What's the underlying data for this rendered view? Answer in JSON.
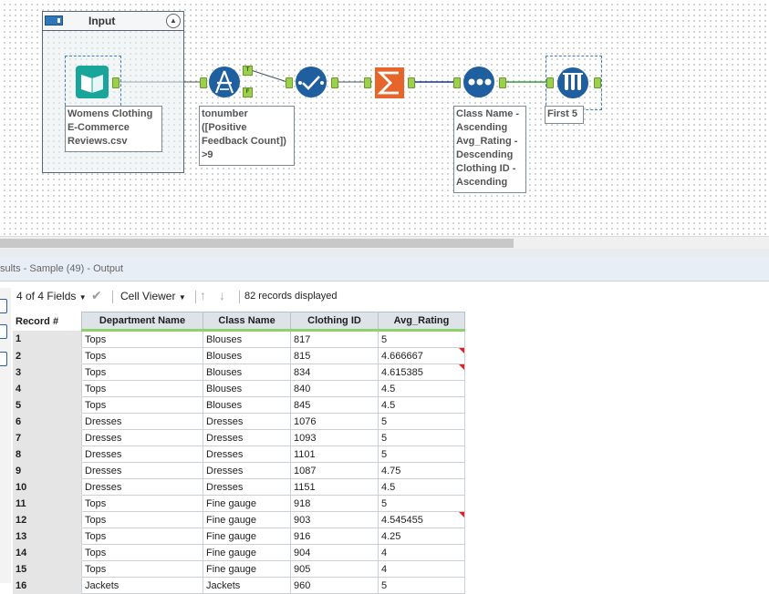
{
  "container": {
    "title": "Input"
  },
  "tools": {
    "input": {
      "label": "Womens Clothing\nE-Commerce\nReviews.csv"
    },
    "filter": {
      "label": "tonumber\n([Positive\nFeedback Count])\n>9",
      "true_anchor": "T",
      "false_anchor": "F"
    },
    "sort": {
      "label": "Class Name -\nAscending\nAvg_Rating -\nDescending\nClothing ID -\nAscending"
    },
    "sample": {
      "label": "First 5"
    }
  },
  "results": {
    "title": "sults - Sample (49) - Output",
    "fields": "4 of 4 Fields",
    "viewer": "Cell Viewer",
    "records": "82 records displayed"
  },
  "table": {
    "columns": [
      "Record #",
      "Department Name",
      "Class Name",
      "Clothing ID",
      "Avg_Rating"
    ],
    "rows": [
      [
        "1",
        "Tops",
        "Blouses",
        "817",
        "5",
        false
      ],
      [
        "2",
        "Tops",
        "Blouses",
        "815",
        "4.666667",
        true
      ],
      [
        "3",
        "Tops",
        "Blouses",
        "834",
        "4.615385",
        true
      ],
      [
        "4",
        "Tops",
        "Blouses",
        "840",
        "4.5",
        false
      ],
      [
        "5",
        "Tops",
        "Blouses",
        "845",
        "4.5",
        false
      ],
      [
        "6",
        "Dresses",
        "Dresses",
        "1076",
        "5",
        false
      ],
      [
        "7",
        "Dresses",
        "Dresses",
        "1093",
        "5",
        false
      ],
      [
        "8",
        "Dresses",
        "Dresses",
        "1101",
        "5",
        false
      ],
      [
        "9",
        "Dresses",
        "Dresses",
        "1087",
        "4.75",
        false
      ],
      [
        "10",
        "Dresses",
        "Dresses",
        "1151",
        "4.5",
        false
      ],
      [
        "11",
        "Tops",
        "Fine gauge",
        "918",
        "5",
        false
      ],
      [
        "12",
        "Tops",
        "Fine gauge",
        "903",
        "4.545455",
        true
      ],
      [
        "13",
        "Tops",
        "Fine gauge",
        "916",
        "4.25",
        false
      ],
      [
        "14",
        "Tops",
        "Fine gauge",
        "904",
        "4",
        false
      ],
      [
        "15",
        "Tops",
        "Fine gauge",
        "905",
        "4",
        false
      ],
      [
        "16",
        "Jackets",
        "Jackets",
        "960",
        "5",
        false
      ]
    ]
  },
  "colors": {
    "accent": "#8fd16a",
    "tool_blue": "#1f5fa0",
    "input_teal": "#1aa59a",
    "summarize_orange": "#e5652b"
  }
}
